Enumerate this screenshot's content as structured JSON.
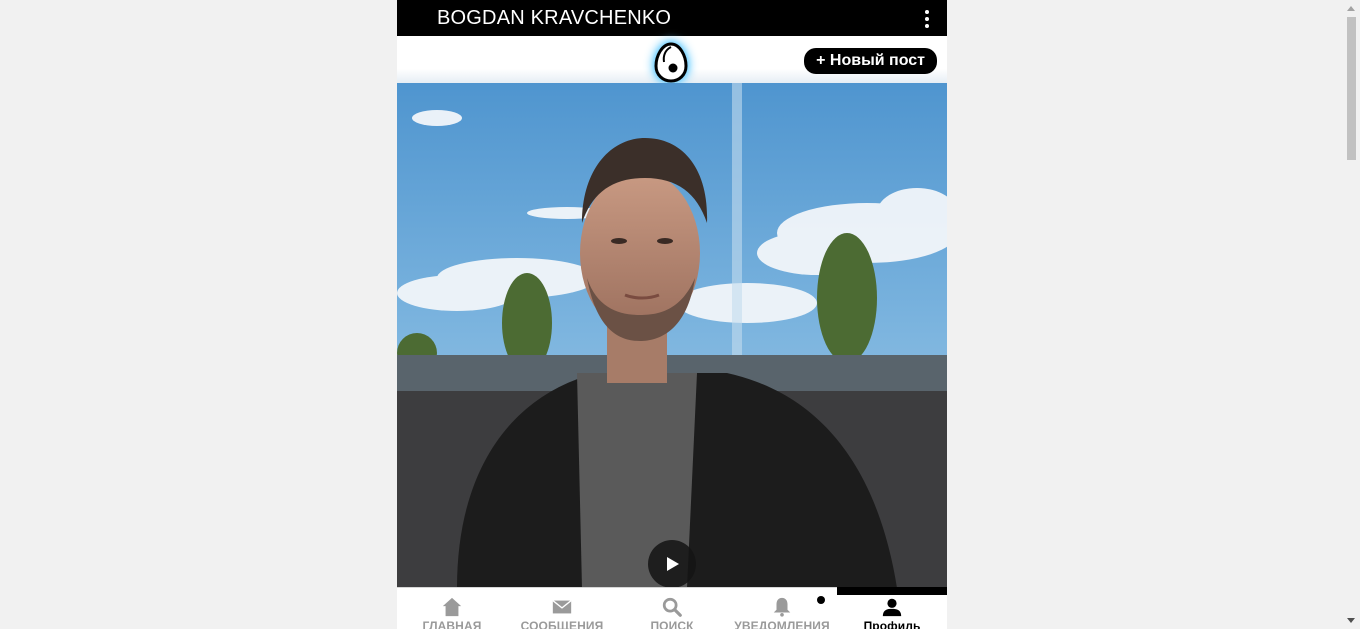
{
  "header": {
    "profile_name": "BOGDAN KRAVCHENKO",
    "menu_icon": "more-vertical-icon"
  },
  "toolbar": {
    "logo_icon": "egg-logo-icon",
    "new_post_label": "+ Новый пост"
  },
  "post": {
    "media_type": "video",
    "play_icon": "play-icon"
  },
  "nav": {
    "items": [
      {
        "label": "ГЛАВНАЯ",
        "icon": "home-icon",
        "active": false
      },
      {
        "label": "СООБЩЕНИЯ",
        "icon": "mail-icon",
        "active": false
      },
      {
        "label": "ПОИСК",
        "icon": "search-icon",
        "active": false
      },
      {
        "label": "УВЕДОМЛЕНИЯ",
        "icon": "bell-icon",
        "active": false,
        "has_unread_dot": true
      },
      {
        "label": "Профиль",
        "icon": "user-icon",
        "active": true
      }
    ]
  },
  "colors": {
    "header_bg": "#000000",
    "page_bg": "#f1f1f1",
    "nav_inactive": "#9a9a9a",
    "nav_active": "#000000",
    "logo_glow": "#4fc3ff"
  }
}
